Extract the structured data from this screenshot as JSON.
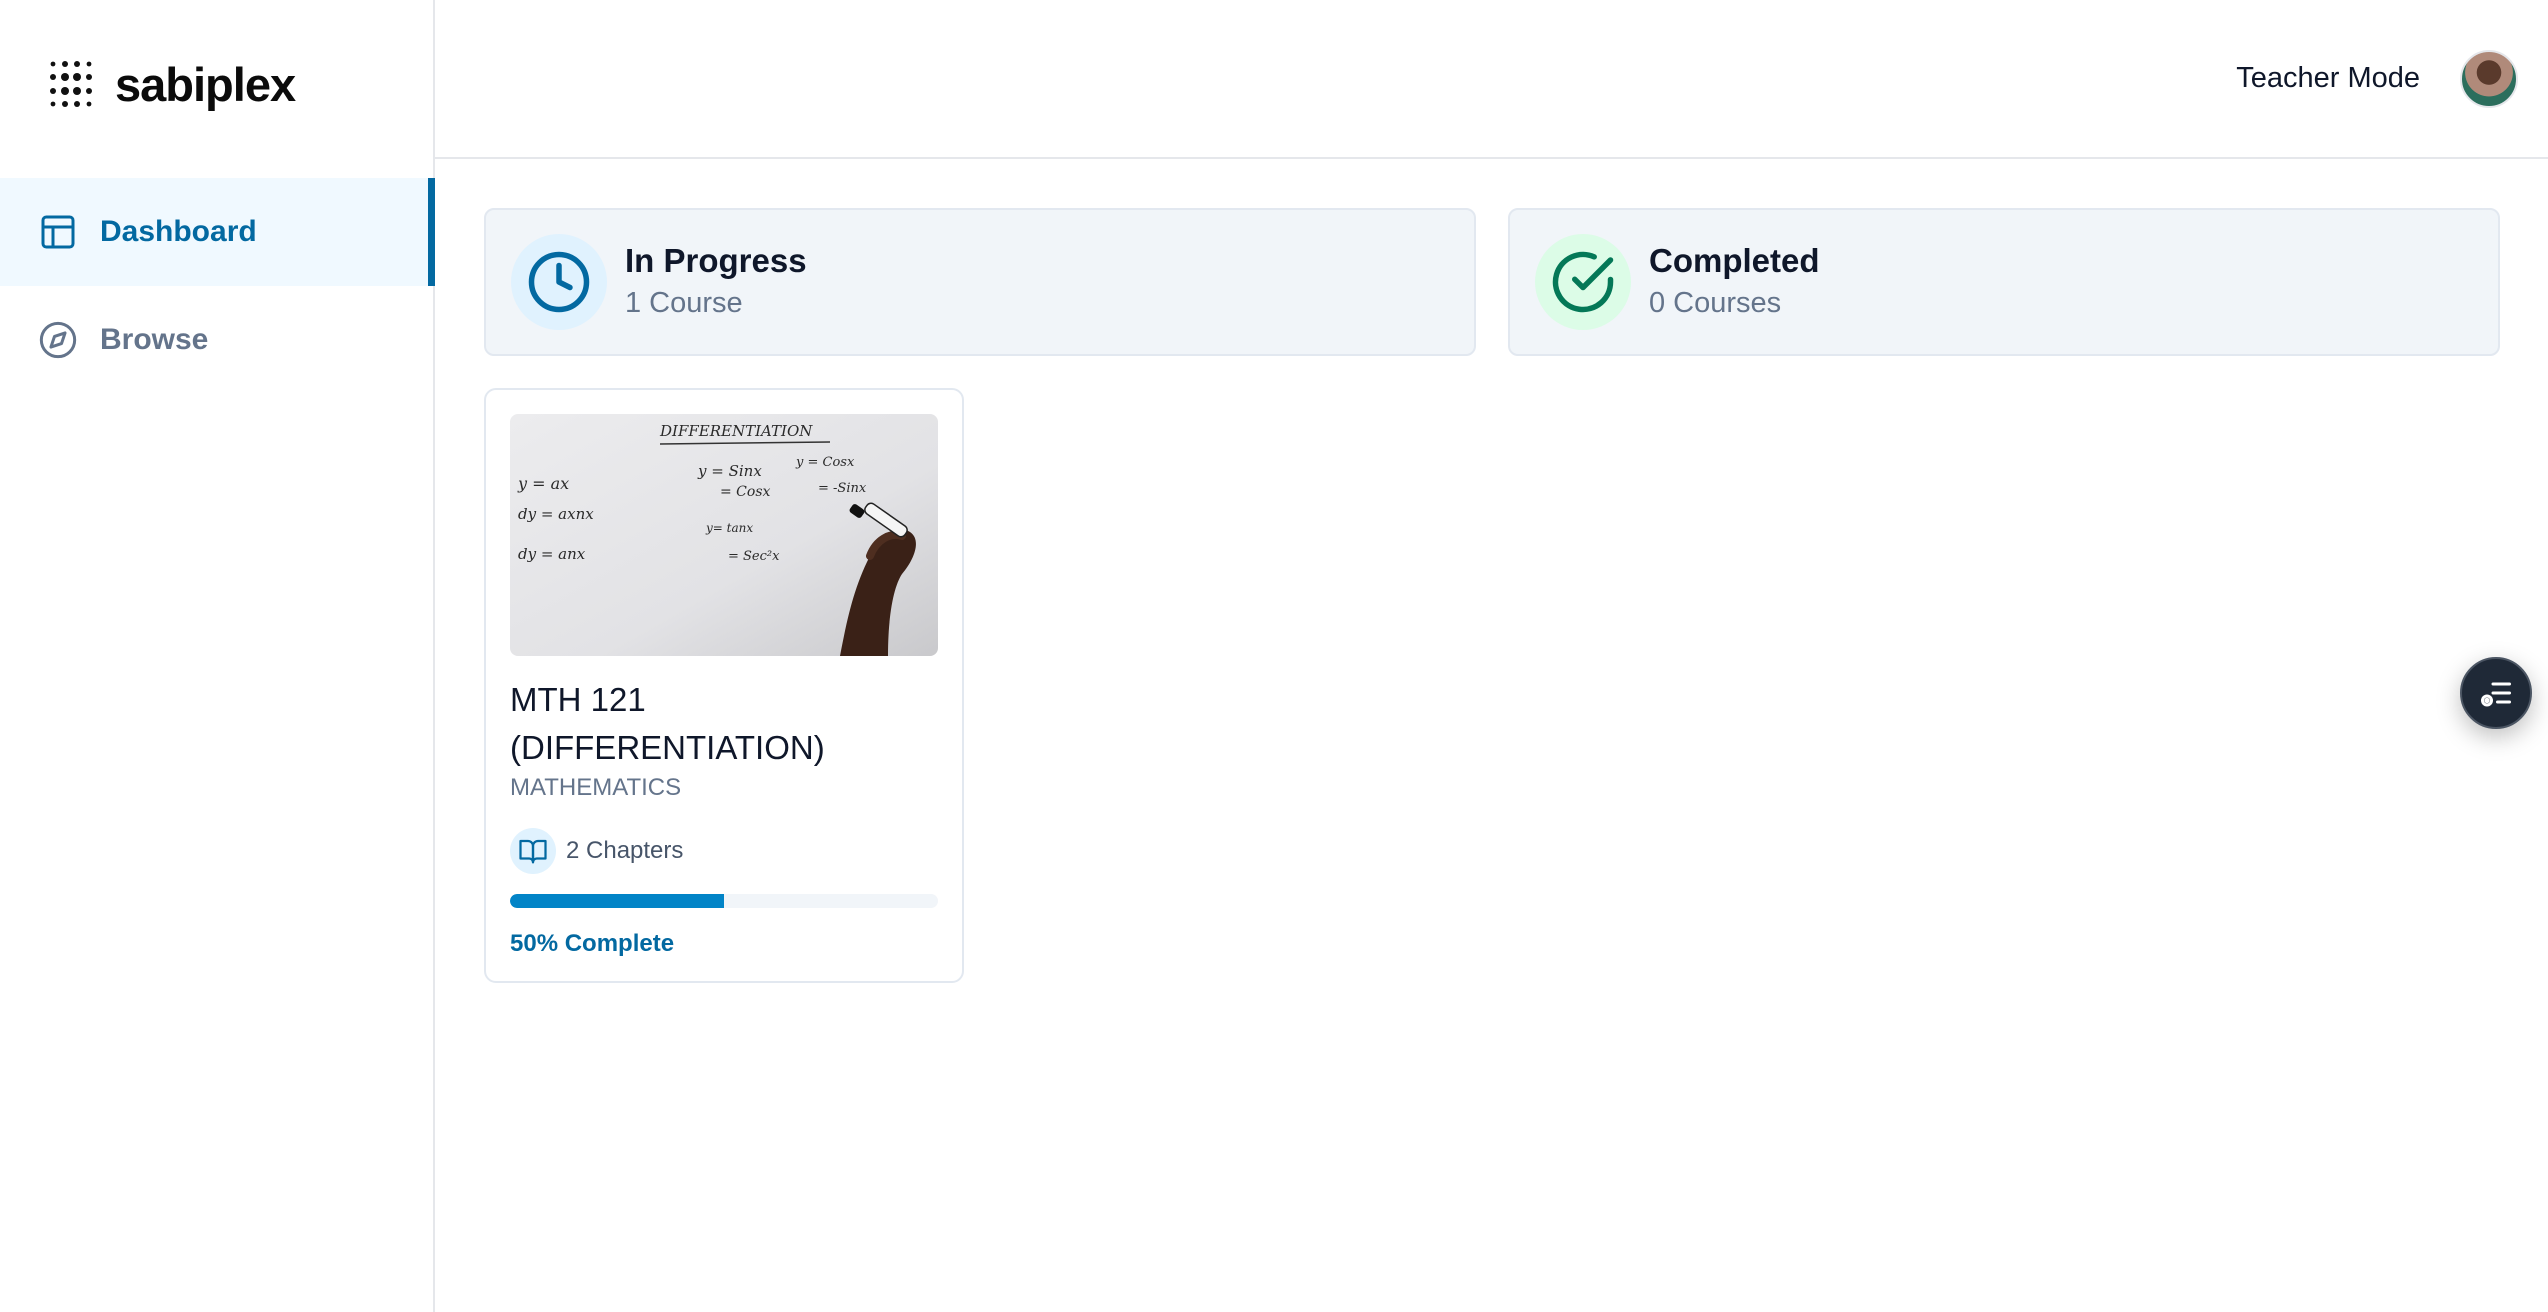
{
  "brand": {
    "name": "sabiplex",
    "icon": "dots-grid-logo-icon"
  },
  "sidebar": {
    "items": [
      {
        "label": "Dashboard",
        "icon": "layout-icon",
        "active": true
      },
      {
        "label": "Browse",
        "icon": "compass-icon",
        "active": false
      }
    ]
  },
  "header": {
    "mode_label": "Teacher Mode",
    "avatar": "user-avatar"
  },
  "stats": {
    "in_progress": {
      "title": "In Progress",
      "subtitle": "1 Course",
      "icon": "clock-icon",
      "color": "#0369a1"
    },
    "completed": {
      "title": "Completed",
      "subtitle": "0 Courses",
      "icon": "check-circle-icon",
      "color": "#047857"
    }
  },
  "courses": [
    {
      "title": "MTH 121 (DIFFERENTIATION)",
      "category": "MATHEMATICS",
      "chapters": "2 Chapters",
      "progress": 0.5,
      "progress_label": "50% Complete",
      "thumbnail_text": {
        "heading": "DIFFERENTIATION",
        "eq1": "y = ax",
        "eq2": "dy = axnx",
        "eq3": "dy = anx",
        "eq4": "y = Sinx",
        "eq5": "y = Cosx",
        "eq6": "= Cosx",
        "eq7": "= -Sinx",
        "eq8": "y= tanx",
        "eq9": "= Sec²x"
      }
    }
  ],
  "fab": {
    "icon": "checklist-icon"
  },
  "colors": {
    "accent": "#0369a1",
    "progress_fill": "#0284c7",
    "success": "#047857"
  }
}
